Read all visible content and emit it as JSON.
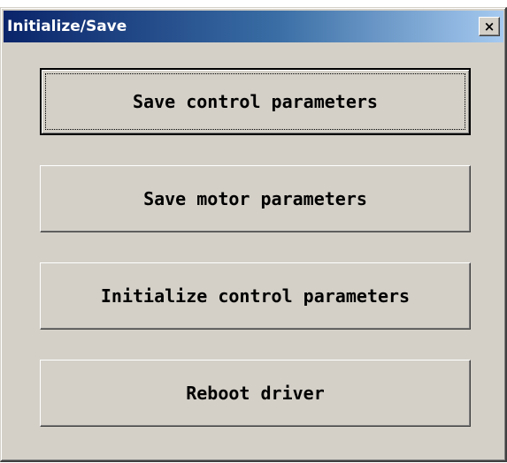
{
  "window": {
    "title": "Initialize/Save",
    "close_label": "×"
  },
  "buttons": [
    {
      "label": "Save control parameters",
      "default": true
    },
    {
      "label": "Save motor parameters"
    },
    {
      "label": "Initialize control parameters"
    },
    {
      "label": "Reboot driver"
    }
  ]
}
